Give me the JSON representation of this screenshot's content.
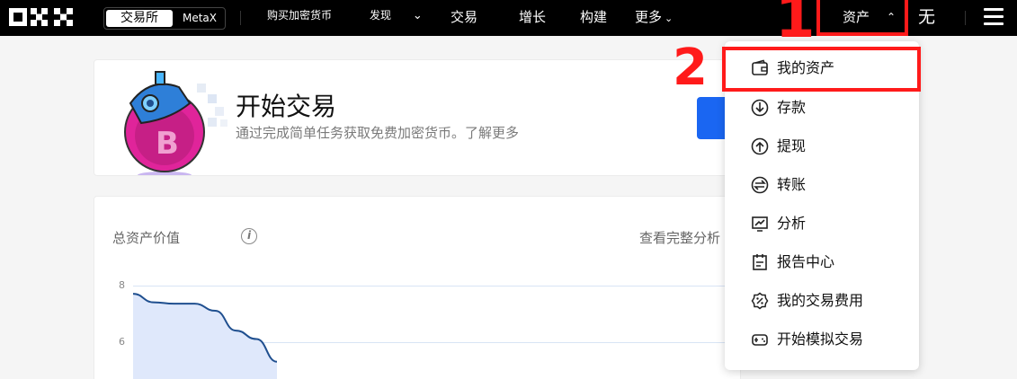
{
  "nav": {
    "logo": "OKX",
    "segment_active": "交易所",
    "segment_inactive": "MetaX",
    "buy_crypto": "购买加密货币",
    "discover": "发现",
    "trade": "交易",
    "grow": "增长",
    "build": "构建",
    "more": "更多",
    "assets": "资产",
    "extra": "无"
  },
  "annotations": {
    "step1": "1",
    "step2": "2",
    "color": "#ff1a1a"
  },
  "promo": {
    "title": "开始交易",
    "subtitle": "通过完成简单任务获取免费加密货币。了解更多"
  },
  "assets_card": {
    "total_label": "总资产价值",
    "view_analysis": "查看完整分析"
  },
  "chart_data": {
    "type": "area",
    "y_ticks": [
      "8",
      "6"
    ],
    "series": [
      {
        "values": [
          7.9,
          7.6,
          7.55,
          7.55,
          7.3,
          6.6,
          6.3,
          5.5
        ]
      }
    ]
  },
  "dropdown": {
    "items": [
      {
        "label": "我的资产",
        "icon": "wallet-icon"
      },
      {
        "label": "存款",
        "icon": "deposit-icon"
      },
      {
        "label": "提现",
        "icon": "withdraw-icon"
      },
      {
        "label": "转账",
        "icon": "transfer-icon"
      },
      {
        "label": "分析",
        "icon": "analysis-icon"
      },
      {
        "label": "报告中心",
        "icon": "report-icon"
      },
      {
        "label": "我的交易费用",
        "icon": "fee-icon"
      },
      {
        "label": "开始模拟交易",
        "icon": "demo-trading-icon"
      }
    ]
  },
  "colors": {
    "accent_blue": "#1a66f2",
    "nav_bg": "#000000"
  }
}
